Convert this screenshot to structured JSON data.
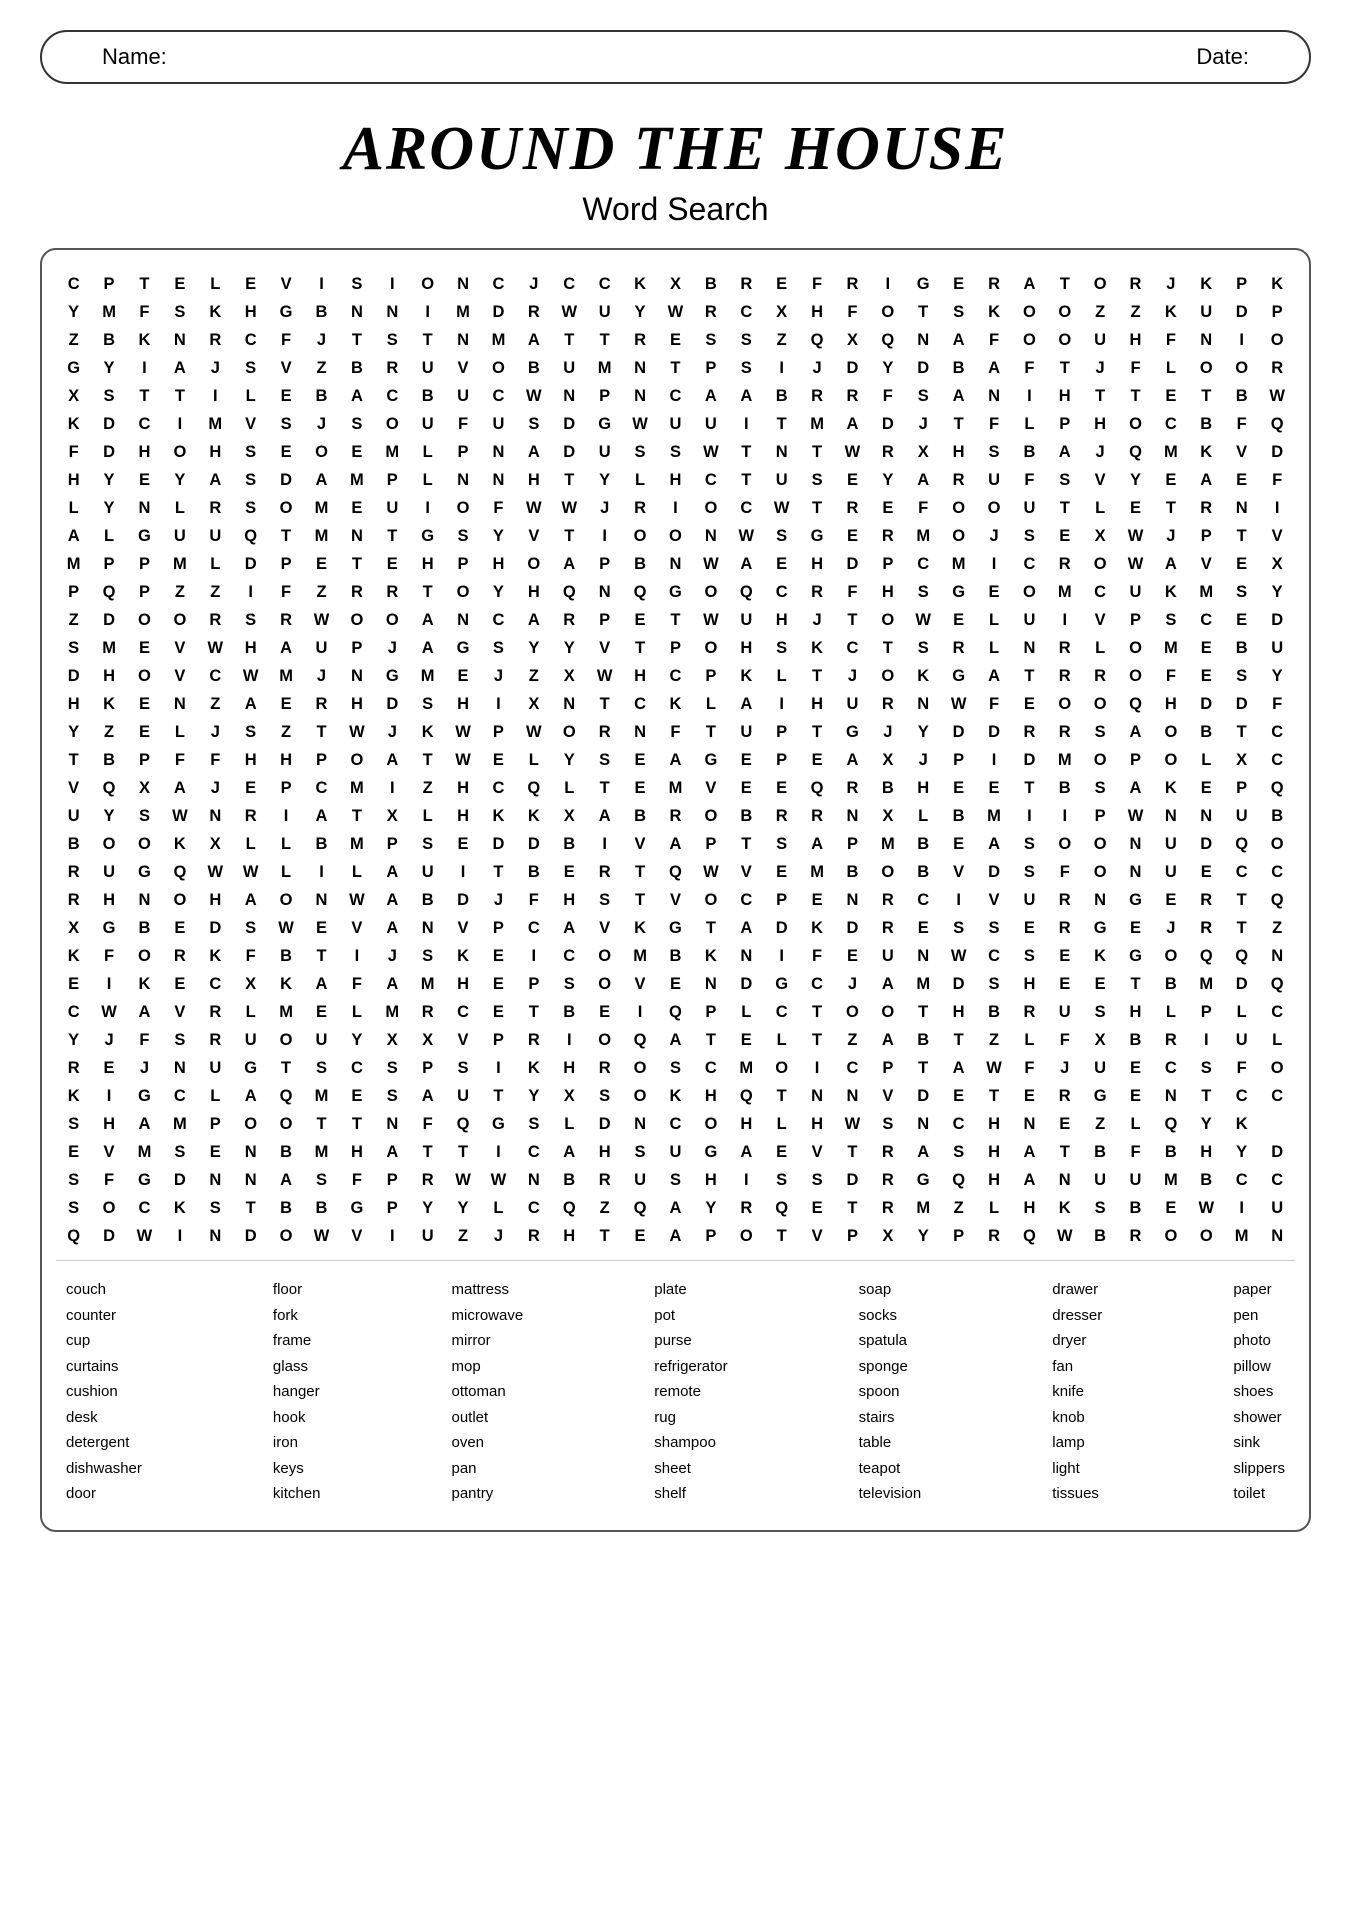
{
  "header": {
    "name_label": "Name:",
    "date_label": "Date:"
  },
  "title": {
    "main": "Around The House",
    "subtitle": "Word Search"
  },
  "grid": [
    "C P T E L E V I S I O N C J C C K X B R E F R I G E R A T O R J K P K",
    "Y M F S K H G B N N I M D R W U Y W R C X H F O T S K O O Z Z K U D P",
    "Z B K N R C F J T S T N M A T T R E S S Z Q X Q N A F O O U H F N I O",
    "G Y I A J S V Z B R U V O B U M N T P S I J D Y D B A F T J F L O O R",
    "X S T T I L E B A C B U C W N P N C A A B R R F S A N I H T T E T B W",
    "K D C I M V S J S O U F U S D G W U U I T M A D J T F L P H O C B F Q",
    "F D H O H S E O E M L P N A D U S S W T N T W R X H S B A J Q M K V D",
    "H Y E Y A S D A M P L N N H T Y L H C T U S E Y A R U F S V Y E A E F",
    "L Y N L R S O M E U I O F W W J R I O C W T R E F O O U T L E T R N I",
    "A L G U U Q T M N T G S Y V T I O O N W S G E R M O J S E X W J P T V",
    "M P P M L D P E T E H P H O A P B N W A E H D P C M I C R O W A V E X",
    "P Q P Z Z I F Z R R T O Y H Q N Q G O Q C R F H S G E O M C U K M S Y",
    "Z D O O R S R W O O A N C A R P E T W U H J T O W E L U I V P S C E D",
    "S M E V W H A U P J A G S Y Y V T P O H S K C T S R L N R L O M E B U",
    "D H O V C W M J N G M E J Z X W H C P K L T J O K G A T R R O F E S Y",
    "H K E N Z A E R H D S H I X N T C K L A I H U R N W F E O O Q H D D F",
    "Y Z E L J S Z T W J K W P W O R N F T U P T G J Y D D R R S A O B T C",
    "T B P F F H H P O A T W E L Y S E A G E P E A X J P I D M O P O L X C",
    "V Q X A J E P C M I Z H C Q L T E M V E E Q R B H E E T B S A K E P Q",
    "U Y S W N R I A T X L H K K X A B R O B R R N X L B M I I P W N N U B",
    "B O O K X L L B M P S E D D B I V A P T S A P M B E A S O O N U D Q O",
    "R U G Q W W L I L A U I T B E R T Q W V E M B O B V D S F O N U E C C",
    "R H N O H A O N W A B D J F H S T V O C P E N R C I V U R N G E R T Q",
    "X G B E D S W E V A N V P C A V K G T A D K D R E S S E R G E J R T Z",
    "K F O R K F B T I J S K E I C O M B K N I F E U N W C S E K G O Q Q N",
    "E I K E C X K A F A M H E P S O V E N D G C J A M D S H E E T B M D Q",
    "C W A V R L M E L M R C E T B E I Q P L C T O O T H B R U S H L P L C",
    "Y J F S R U O U Y X X V P R I O Q A T E L T Z A B T Z L F X B R I U L",
    "R E J N U G T S C S P S I K H R O S C M O I C P T A W F J U E C S F O",
    "K I G C L A Q M E S A U T Y X S O K H Q T N N V D E T E R G E N T C C",
    "S H A M P O O T T N F Q G S L D N C O H L H W S N C H N E Z L Q Y K",
    "E V M S E N B M H A T T I C A H S U G A E V T R A S H A T B F B H Y D",
    "S F G D N N A S F P R W W N B R U S H I S S D R G Q H A N U U M B C C",
    "S O C K S T B B G P Y Y L C Q Z Q A Y R Q E T R M Z L H K S B E W I U",
    "Q D W I N D O W V I U Z J R H T E A P O T V P X Y P R Q W B R O O M N"
  ],
  "words": {
    "col1": [
      "couch",
      "counter",
      "cup",
      "curtains",
      "cushion",
      "desk",
      "detergent",
      "dishwasher",
      "door"
    ],
    "col2": [
      "floor",
      "fork",
      "frame",
      "glass",
      "hanger",
      "hook",
      "iron",
      "keys",
      "kitchen"
    ],
    "col3": [
      "mattress",
      "microwave",
      "mirror",
      "mop",
      "ottoman",
      "outlet",
      "oven",
      "pan",
      "pantry"
    ],
    "col4": [
      "plate",
      "pot",
      "purse",
      "refrigerator",
      "remote",
      "rug",
      "shampoo",
      "sheet",
      "shelf"
    ],
    "col5": [
      "soap",
      "socks",
      "spatula",
      "sponge",
      "spoon",
      "stairs",
      "table",
      "teapot",
      "television"
    ],
    "col6": [
      "drawer",
      "dresser",
      "dryer",
      "fan",
      "knife",
      "knob",
      "lamp",
      "light",
      "tissues"
    ],
    "col7": [
      "paper",
      "pen",
      "photo",
      "pillow",
      "shoes",
      "shower",
      "sink",
      "slippers",
      "toilet"
    ]
  }
}
